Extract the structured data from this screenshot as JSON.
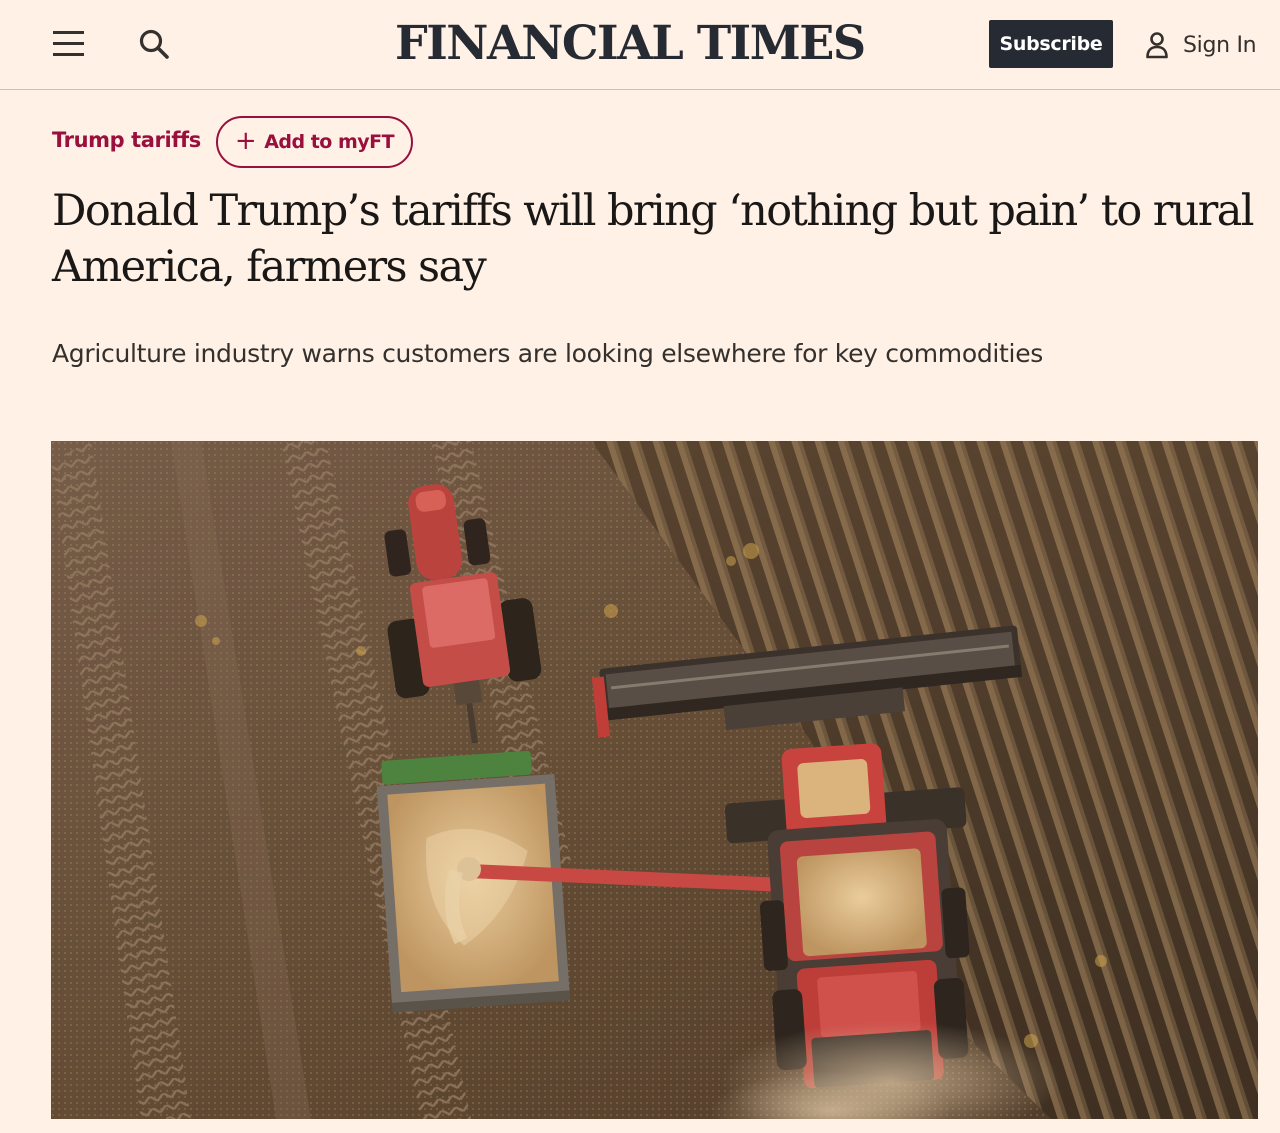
{
  "header": {
    "menu_icon": "hamburger-menu-icon",
    "search_icon": "search-icon",
    "logo": "FINANCIAL TIMES",
    "subscribe_label": "Subscribe",
    "signin_icon": "user-icon",
    "signin_label": "Sign In"
  },
  "article": {
    "topic": "Trump tariffs",
    "myft_plus": "+",
    "myft_label": "Add to myFT",
    "headline": "Donald Trump’s tariffs will bring ‘nothing but pain’ to rural America, farmers say",
    "standfirst": "Agriculture industry warns customers are looking elsewhere for key commodities",
    "image_alt": "Aerial view of a red combine harvester unloading grain into a trailer pulled by a red tractor in a field"
  },
  "colors": {
    "background": "#FFF1E5",
    "accent": "#990F3D",
    "dark": "#262A33",
    "text": "#33302E"
  }
}
